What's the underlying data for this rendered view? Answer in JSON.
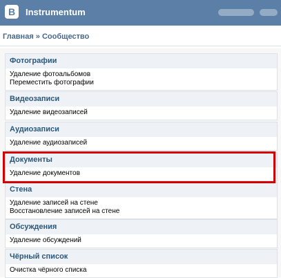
{
  "header": {
    "app_title": "Instrumentum",
    "logo_letter": "B"
  },
  "breadcrumb": {
    "home": "Главная",
    "separator": " » ",
    "current": "Сообщество"
  },
  "sections": [
    {
      "title": "Фотографии",
      "items": [
        "Удаление фотоальбомов",
        "Переместить фотографии"
      ]
    },
    {
      "title": "Видеозаписи",
      "items": [
        "Удаление видеозаписей"
      ]
    },
    {
      "title": "Аудиозаписи",
      "items": [
        "Удаление аудиозаписей"
      ]
    },
    {
      "title": "Документы",
      "items": [
        "Удаление документов"
      ]
    },
    {
      "title": "Стена",
      "items": [
        "Удаление записей на стене",
        "Восстановление записей на стене"
      ]
    },
    {
      "title": "Обсуждения",
      "items": [
        "Удаление обсуждений"
      ]
    },
    {
      "title": "Чёрный список",
      "items": [
        "Очистка чёрного списка"
      ]
    }
  ],
  "colors": {
    "topbar": "#5b7fa6",
    "link": "#45688e",
    "highlight": "#d40000"
  }
}
